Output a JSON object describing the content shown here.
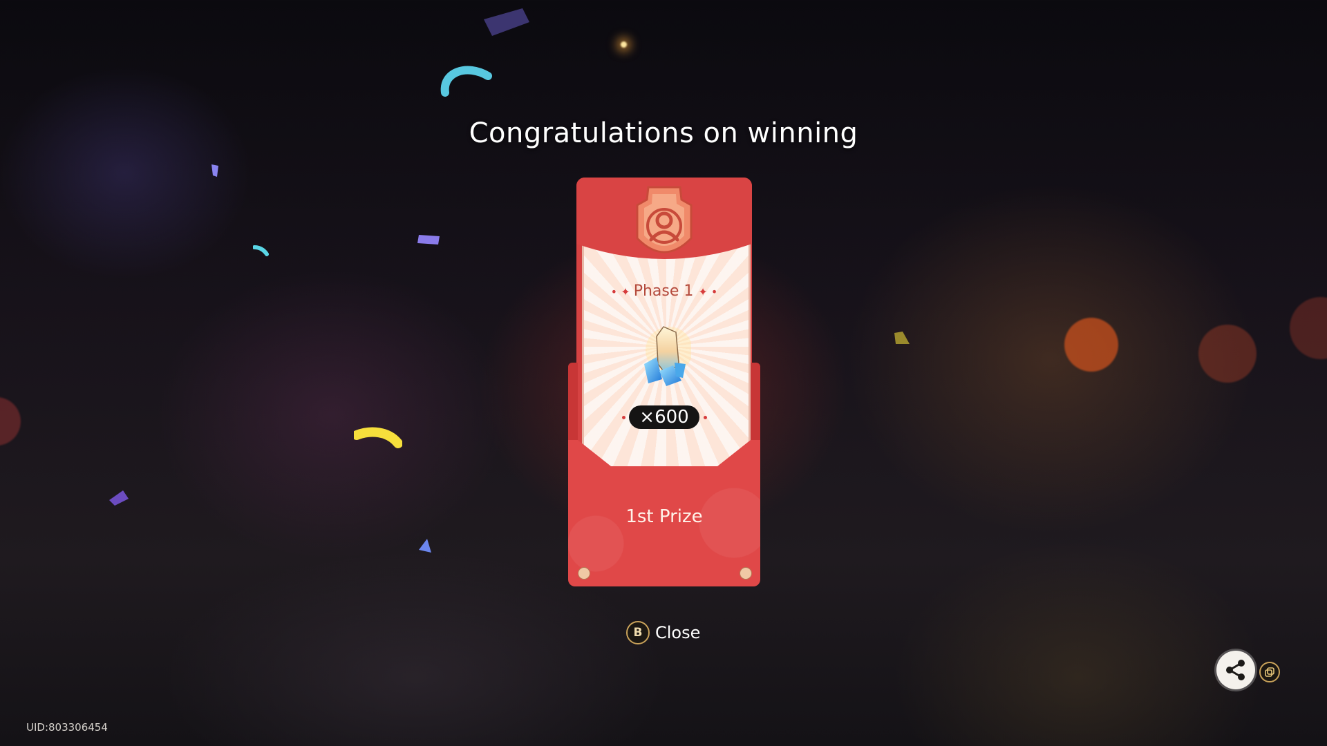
{
  "title": "Congratulations on winning",
  "card": {
    "phase_label": "Phase 1",
    "reward_icon": "primogem-crystal-icon",
    "quantity": "×600",
    "prize_label": "1st Prize",
    "emblem_icon": "badge-emblem-icon"
  },
  "close": {
    "button_glyph": "B",
    "label": "Close"
  },
  "share": {
    "icon": "share-icon",
    "sub_icon": "copy-icon"
  },
  "uid": "UID:803306454",
  "colors": {
    "card_red": "#d94444",
    "paper": "#fbe9df",
    "accent_gold": "#c9a25a"
  }
}
